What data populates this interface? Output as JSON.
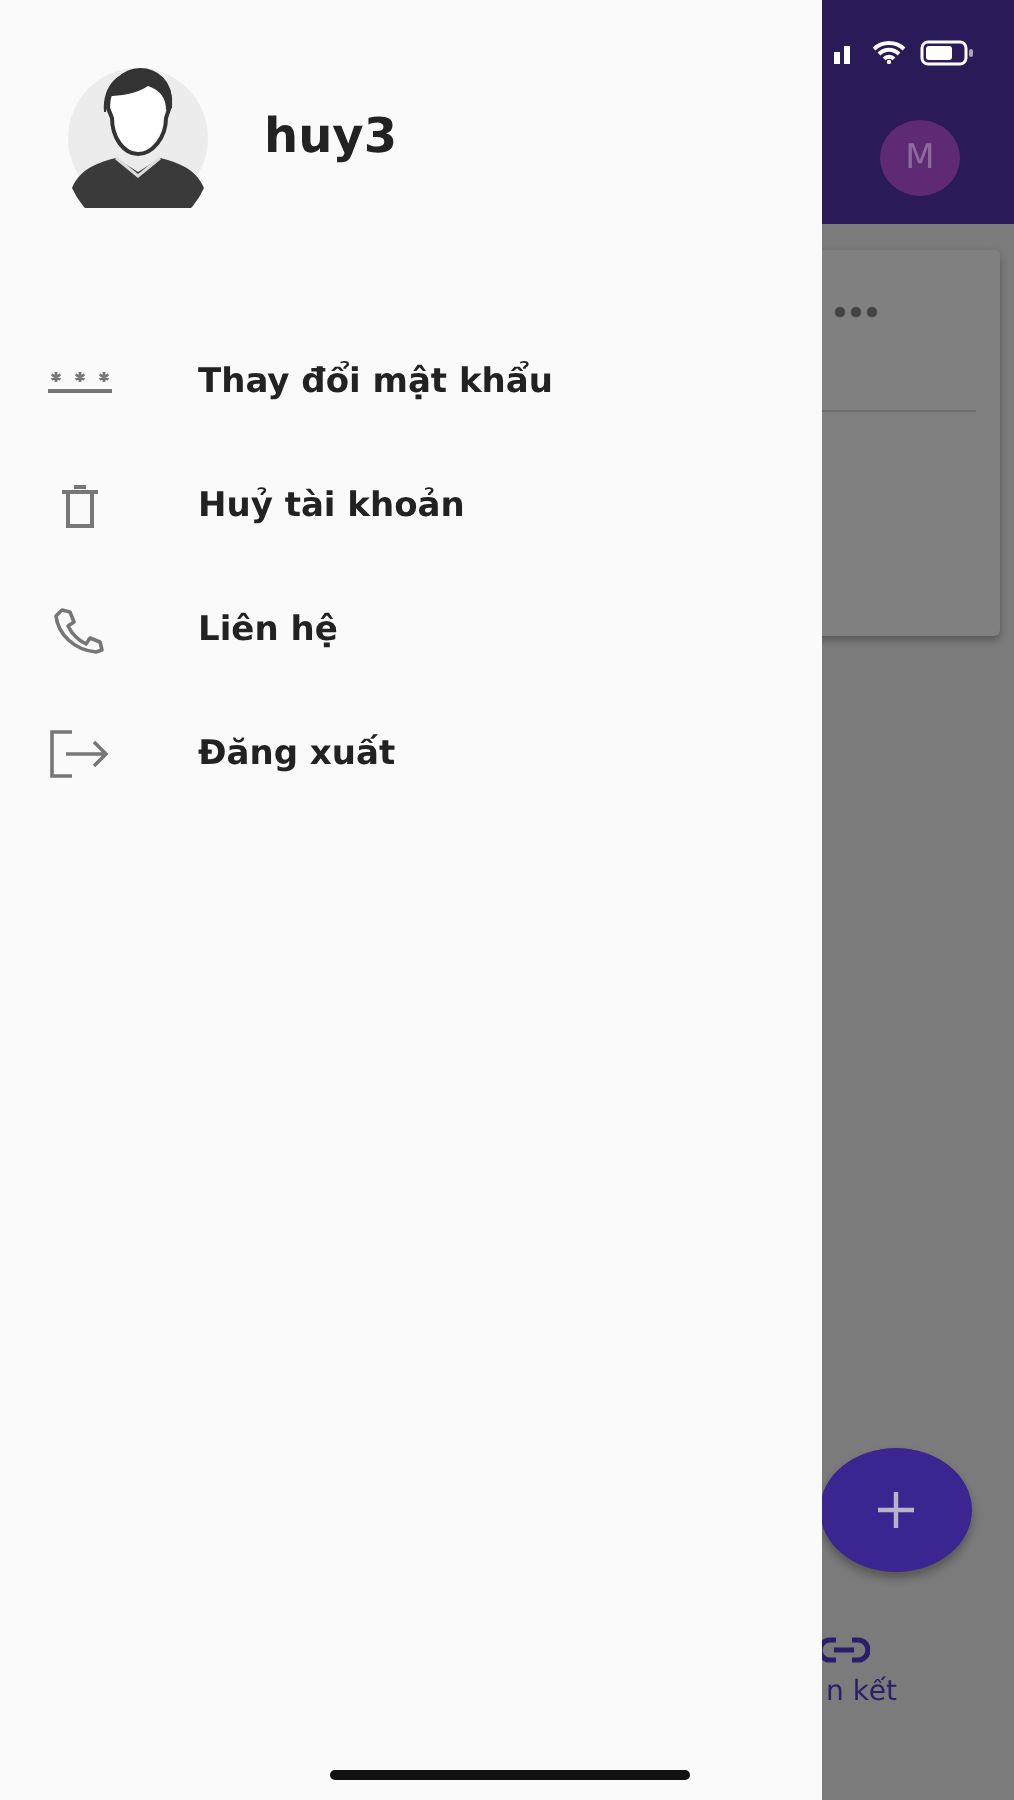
{
  "drawer": {
    "user": {
      "name": "huy3"
    },
    "items": [
      {
        "label": "Thay đổi mật khẩu",
        "kind": "password"
      },
      {
        "label": "Huỷ tài khoản",
        "kind": "delete"
      },
      {
        "label": "Liên hệ",
        "kind": "phone"
      },
      {
        "label": "Đăng xuất",
        "kind": "logout"
      }
    ]
  },
  "app_bar": {
    "avatar_letter": "M"
  },
  "bottom_nav": {
    "label": "n kết"
  }
}
